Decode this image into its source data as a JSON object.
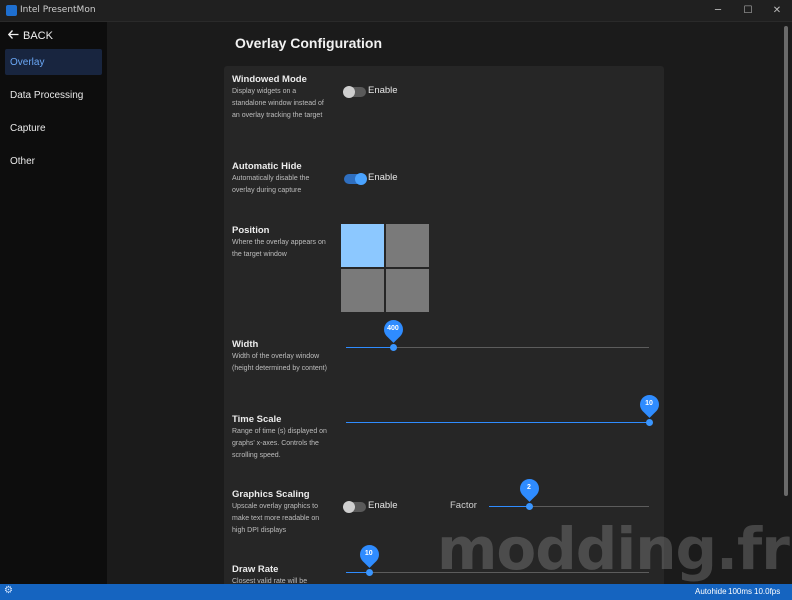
{
  "window": {
    "title": "Intel PresentMon",
    "minimize_icon": "minimize-icon",
    "maximize_icon": "maximize-icon",
    "close_icon": "close-icon"
  },
  "sidebar": {
    "back_label": "BACK",
    "items": [
      {
        "label": "Overlay",
        "active": true
      },
      {
        "label": "Data Processing",
        "active": false
      },
      {
        "label": "Capture",
        "active": false
      },
      {
        "label": "Other",
        "active": false
      }
    ]
  },
  "page": {
    "title": "Overlay Configuration"
  },
  "settings": {
    "windowed_mode": {
      "title": "Windowed Mode",
      "desc": "Display widgets on a standalone window instead of an overlay tracking the target",
      "toggle_label": "Enable",
      "enabled": false
    },
    "automatic_hide": {
      "title": "Automatic Hide",
      "desc": "Automatically disable the overlay during capture",
      "toggle_label": "Enable",
      "enabled": true
    },
    "position": {
      "title": "Position",
      "desc": "Where the overlay appears on the target window",
      "selected": "top-left"
    },
    "width": {
      "title": "Width",
      "desc": "Width of the overlay window (height determined by content)",
      "value": "400",
      "fraction": 0.155
    },
    "time_scale": {
      "title": "Time Scale",
      "desc": "Range of time (s) displayed on graphs' x-axes. Controls the scrolling speed.",
      "value": "10",
      "fraction": 1.0
    },
    "graphics_scaling": {
      "title": "Graphics Scaling",
      "desc": "Upscale overlay graphics to make text more readable on high DPI displays",
      "toggle_label": "Enable",
      "enabled": false,
      "factor_label": "Factor",
      "factor_value": "2",
      "fraction": 0.25
    },
    "draw_rate": {
      "title": "Draw Rate",
      "desc": "Closest valid rate will be",
      "value": "10",
      "fraction": 0.075
    }
  },
  "watermark": "modding.fr",
  "statusbar": {
    "autohide": "Autohide",
    "interval": "100ms",
    "fps": "10.0fps",
    "gear_icon": "gear-icon"
  },
  "colors": {
    "accent": "#2f8cff",
    "sidebar_active_bg": "#18253f",
    "statusbar": "#1564c0",
    "position_selected": "#8cc8ff"
  }
}
